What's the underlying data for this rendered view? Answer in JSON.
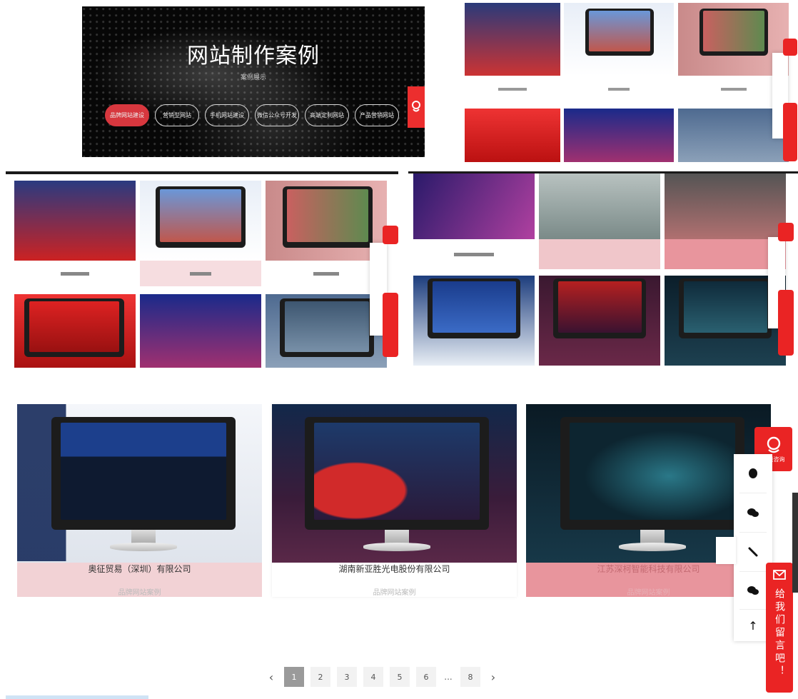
{
  "hero": {
    "title": "网站制作案例",
    "subtitle": "案例展示",
    "categories": [
      "品牌网站建设",
      "营销型网站",
      "手机网站建设",
      "微信公众号开发",
      "高端定制网站",
      "产品营销网站"
    ],
    "active_index": 0
  },
  "featured": [
    {
      "name": "奥征贸易（深圳）有限公司",
      "tag": "品牌网站案例"
    },
    {
      "name": "湖南新亚胜光电股份有限公司",
      "tag": "品牌网站案例"
    },
    {
      "name": "江苏深柯智能科技有限公司",
      "tag": "品牌网站案例"
    }
  ],
  "side_panel": {
    "consult_label": "在线咨询",
    "message_label": "给我们留言吧！",
    "icons": [
      "qq-icon",
      "wechat-icon",
      "phone-icon",
      "chat-icon",
      "back-to-top-icon"
    ]
  },
  "pagination": {
    "prev": "‹",
    "next": "›",
    "pages": [
      "1",
      "2",
      "3",
      "4",
      "5",
      "6"
    ],
    "ellipsis": "...",
    "last": "8",
    "current": "1"
  },
  "colors": {
    "accent": "#ea2424",
    "pink_caption": "#f2d2d5",
    "hot_pink_caption": "#e8959d"
  }
}
